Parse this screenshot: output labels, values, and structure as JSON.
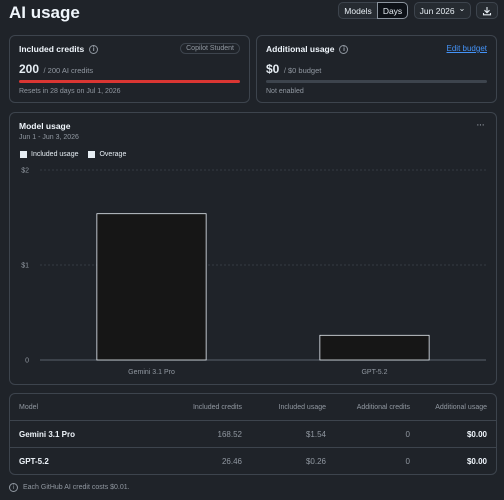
{
  "page": {
    "title": "AI usage"
  },
  "toolbar": {
    "models_label": "Models",
    "days_label": "Days",
    "month_label": "Jun 2026",
    "chevron": "⌄",
    "download_icon": "download-icon"
  },
  "included": {
    "title": "Included credits",
    "badge": "Copilot Student",
    "amount": "200",
    "amount_suffix": "/ 200 AI credits",
    "progress_fraction": 1.0,
    "progress_color": "#da3633",
    "footer": "Resets in 28 days on Jul 1, 2026"
  },
  "additional": {
    "title": "Additional usage",
    "link": "Edit budget",
    "amount": "$0",
    "amount_suffix": "/ $0 budget",
    "progress_fraction": 0,
    "footer": "Not enabled"
  },
  "model_usage": {
    "title": "Model usage",
    "subtitle": "Jun 1 - Jun 3, 2026",
    "menu": "···",
    "legend": [
      "Included usage",
      "Overage"
    ]
  },
  "chart_data": {
    "type": "bar",
    "categories": [
      "Gemini 3.1 Pro",
      "GPT-5.2"
    ],
    "series": [
      {
        "name": "Included usage",
        "values": [
          1.54,
          0.26
        ]
      },
      {
        "name": "Overage",
        "values": [
          0,
          0
        ]
      }
    ],
    "ylim": [
      0,
      2
    ],
    "yticks": [
      {
        "value": 0,
        "label": "0"
      },
      {
        "value": 1,
        "label": "$1"
      },
      {
        "value": 2,
        "label": "$2"
      }
    ],
    "grid": true,
    "legend": "top-left"
  },
  "table": {
    "headers": [
      "Model",
      "Included credits",
      "Included usage",
      "Additional credits",
      "Additional usage"
    ],
    "rows": [
      [
        "Gemini 3.1 Pro",
        "168.52",
        "$1.54",
        "0",
        "$0.00"
      ],
      [
        "GPT-5.2",
        "26.46",
        "$0.26",
        "0",
        "$0.00"
      ]
    ]
  },
  "footnote": "Each GitHub AI credit costs $0.01.",
  "colors": {
    "background": "#1f2329",
    "border": "#3d444d",
    "link": "#4493f8",
    "bar_fill": "#161616",
    "bar_stroke": "#e6edf3"
  }
}
